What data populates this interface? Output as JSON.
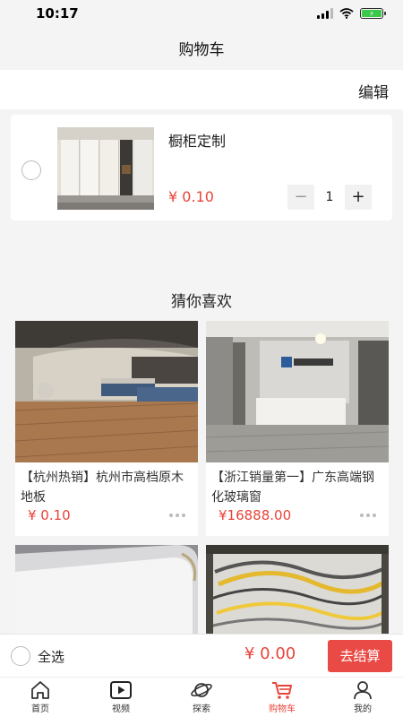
{
  "status": {
    "time": "10:17"
  },
  "header": {
    "title": "购物车",
    "edit_label": "编辑"
  },
  "cart": {
    "items": [
      {
        "name": "橱柜定制",
        "price": "¥ 0.10",
        "quantity": "1",
        "minus": "−",
        "plus": "+"
      }
    ]
  },
  "recommend": {
    "title": "猜你喜欢",
    "items": [
      {
        "title": "【杭州热销】杭州市高档原木地板",
        "price": "¥ 0.10"
      },
      {
        "title": "【浙江销量第一】广东高端钢化玻璃窗",
        "price": "¥16888.00"
      },
      {
        "title": "",
        "price": ""
      },
      {
        "title": "",
        "price": ""
      }
    ]
  },
  "footer": {
    "select_all": "全选",
    "total": "¥ 0.00",
    "checkout": "去结算"
  },
  "tabs": [
    {
      "label": "首页",
      "icon": "home-icon"
    },
    {
      "label": "视频",
      "icon": "video-icon"
    },
    {
      "label": "探索",
      "icon": "planet-icon"
    },
    {
      "label": "购物车",
      "icon": "cart-icon"
    },
    {
      "label": "我的",
      "icon": "user-icon"
    }
  ],
  "colors": {
    "accent": "#e8443a",
    "checkout_bg": "#ea4a45"
  }
}
